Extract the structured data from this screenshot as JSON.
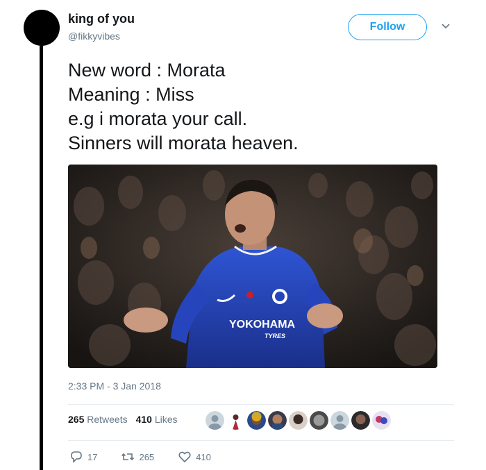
{
  "user": {
    "name": "king of you",
    "handle": "@fikkyvibes"
  },
  "follow_label": "Follow",
  "tweet_lines": [
    "New word : Morata",
    "Meaning : Miss",
    "e.g i morata your call.",
    "Sinners will morata heaven."
  ],
  "photo": {
    "shirt_sponsor": "YOKOHAMA",
    "shirt_sponsor_sub": "TYRES",
    "colors": {
      "shirt": "#1f3fb0",
      "crowd": "#2a2522"
    }
  },
  "timestamp": "2:33 PM - 3 Jan 2018",
  "stats": {
    "retweets_count": "265",
    "retweets_label": "Retweets",
    "likes_count": "410",
    "likes_label": "Likes"
  },
  "actions": {
    "replies": "17",
    "retweets": "265",
    "likes": "410"
  },
  "colors": {
    "accent": "#1da1f2",
    "muted": "#657786",
    "text": "#14171a"
  }
}
